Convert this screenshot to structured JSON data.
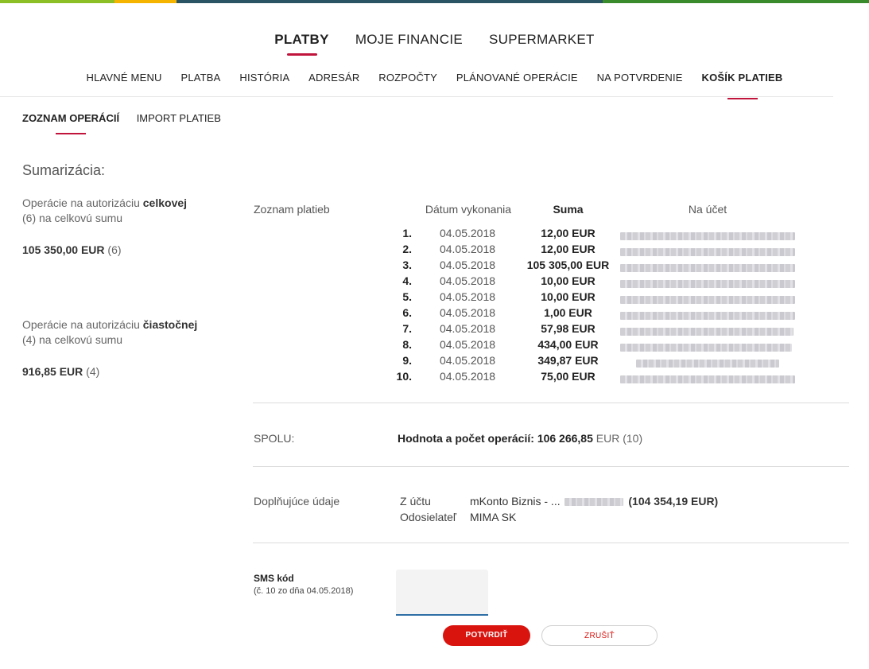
{
  "brand_colors": {
    "accent": "#c0143c",
    "button_red": "#d9140f",
    "topbar": [
      "#8cbf26",
      "#f5b400",
      "#2a5364",
      "#3a8b2c"
    ]
  },
  "main_nav": [
    {
      "label": "PLATBY",
      "active": true
    },
    {
      "label": "MOJE FINANCIE",
      "active": false
    },
    {
      "label": "SUPERMARKET",
      "active": false
    }
  ],
  "sub_nav": [
    {
      "label": "HLAVNÉ MENU"
    },
    {
      "label": "PLATBA"
    },
    {
      "label": "HISTÓRIA"
    },
    {
      "label": "ADRESÁR"
    },
    {
      "label": "ROZPOČTY"
    },
    {
      "label": "PLÁNOVANÉ OPERÁCIE"
    },
    {
      "label": "NA POTVRDENIE"
    },
    {
      "label": "KOŠÍK PLATIEB",
      "active": true
    }
  ],
  "tabs": [
    {
      "label": "ZOZNAM OPERÁCIÍ",
      "active": true
    },
    {
      "label": "IMPORT PLATIEB"
    }
  ],
  "summary": {
    "title": "Sumarizácia:",
    "full": {
      "prefix": "Operácie na autorizáciu ",
      "bold": "celkovej",
      "line2": "(6) na celkovú sumu",
      "amount": "105 350,00 EUR",
      "count": "(6)"
    },
    "partial": {
      "prefix": "Operácie na autorizáciu ",
      "bold": "čiastočnej",
      "line2": "(4) na celkovú sumu",
      "amount": "916,85 EUR",
      "count": "(4)"
    }
  },
  "payments": {
    "label": "Zoznam platieb",
    "headers": {
      "date": "Dátum vykonania",
      "sum": "Suma",
      "account": "Na účet"
    },
    "rows": [
      {
        "n": "1.",
        "date": "04.05.2018",
        "sum": "12,00 EUR"
      },
      {
        "n": "2.",
        "date": "04.05.2018",
        "sum": "12,00 EUR"
      },
      {
        "n": "3.",
        "date": "04.05.2018",
        "sum": "105 305,00 EUR"
      },
      {
        "n": "4.",
        "date": "04.05.2018",
        "sum": "10,00 EUR"
      },
      {
        "n": "5.",
        "date": "04.05.2018",
        "sum": "10,00 EUR"
      },
      {
        "n": "6.",
        "date": "04.05.2018",
        "sum": "1,00 EUR"
      },
      {
        "n": "7.",
        "date": "04.05.2018",
        "sum": "57,98 EUR"
      },
      {
        "n": "8.",
        "date": "04.05.2018",
        "sum": "434,00 EUR"
      },
      {
        "n": "9.",
        "date": "04.05.2018",
        "sum": "349,87 EUR"
      },
      {
        "n": "10.",
        "date": "04.05.2018",
        "sum": "75,00 EUR"
      }
    ]
  },
  "spolu": {
    "label": "SPOLU:",
    "text": "Hodnota a počet operácií:",
    "value": "106 266,85",
    "unit": "EUR",
    "count": "(10)"
  },
  "extra": {
    "label": "Doplňujúce údaje",
    "from_key": "Z účtu",
    "from_val": "mKonto Biznis - ...",
    "balance": "(104 354,19 EUR)",
    "sender_key": "Odosielateľ",
    "sender_val": "MIMA SK"
  },
  "sms": {
    "label": "SMS kód",
    "sub": "(č. 10 zo dňa 04.05.2018)",
    "value": ""
  },
  "buttons": {
    "confirm": "POTVRDIŤ",
    "cancel": "ZRUŠIŤ"
  }
}
